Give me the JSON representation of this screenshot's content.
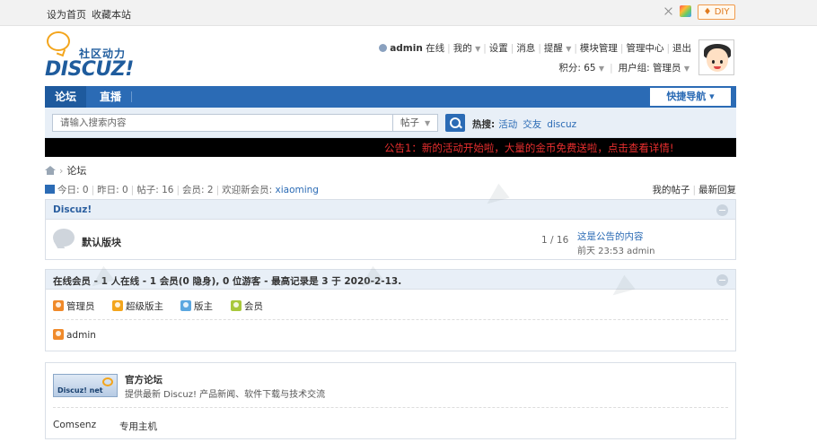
{
  "topbar": {
    "set_home": "设为首页",
    "bookmark": "收藏本站",
    "diy": "DIY"
  },
  "logo": {
    "cn_text": "社区动力",
    "en_text": "DISCUZ!"
  },
  "user": {
    "name": "admin",
    "status": "在线",
    "menu": [
      "我的",
      "设置",
      "消息",
      "提醒",
      "模块管理",
      "管理中心",
      "退出"
    ],
    "credits": "积分: 65",
    "group": "用户组: 管理员"
  },
  "nav": {
    "tabs": [
      "论坛",
      "直播"
    ],
    "quick_nav": "快捷导航"
  },
  "search": {
    "placeholder": "请输入搜索内容",
    "type": "帖子",
    "hot_label": "热搜:",
    "hot_words": [
      "活动",
      "交友",
      "discuz"
    ]
  },
  "announcement": "公告1：新的活动开始啦，大量的金币免费送啦，点击查看详情!",
  "breadcrumb": {
    "current": "论坛"
  },
  "stats": {
    "today": "今日: 0",
    "yesterday": "昨日: 0",
    "posts": "帖子: 16",
    "members": "会员: 2",
    "welcome_prefix": "欢迎新会员:",
    "new_member": "xiaoming",
    "my_posts": "我的帖子",
    "latest_reply": "最新回复"
  },
  "category": {
    "title": "Discuz!",
    "forum": {
      "name": "默认版块",
      "count": "1 / 16",
      "last_title": "这是公告的内容",
      "last_meta": "前天 23:53 admin"
    }
  },
  "online": {
    "title": "在线会员 - 1 人在线 - 1 会员(0 隐身), 0 位游客 - 最高记录是 3 于 2020-2-13.",
    "legend": [
      {
        "label": "管理员",
        "color": "#f08a2a"
      },
      {
        "label": "超级版主",
        "color": "#f3a51c"
      },
      {
        "label": "版主",
        "color": "#5ba7e0"
      },
      {
        "label": "会员",
        "color": "#a8c83c"
      }
    ],
    "users": [
      {
        "name": "admin",
        "color": "#f08a2a"
      }
    ]
  },
  "links": {
    "logo_text": "Discuz! net",
    "title": "官方论坛",
    "desc": "提供最新 Discuz! 产品新闻、软件下载与技术交流",
    "text_links": [
      "Comsenz",
      "专用主机"
    ]
  }
}
